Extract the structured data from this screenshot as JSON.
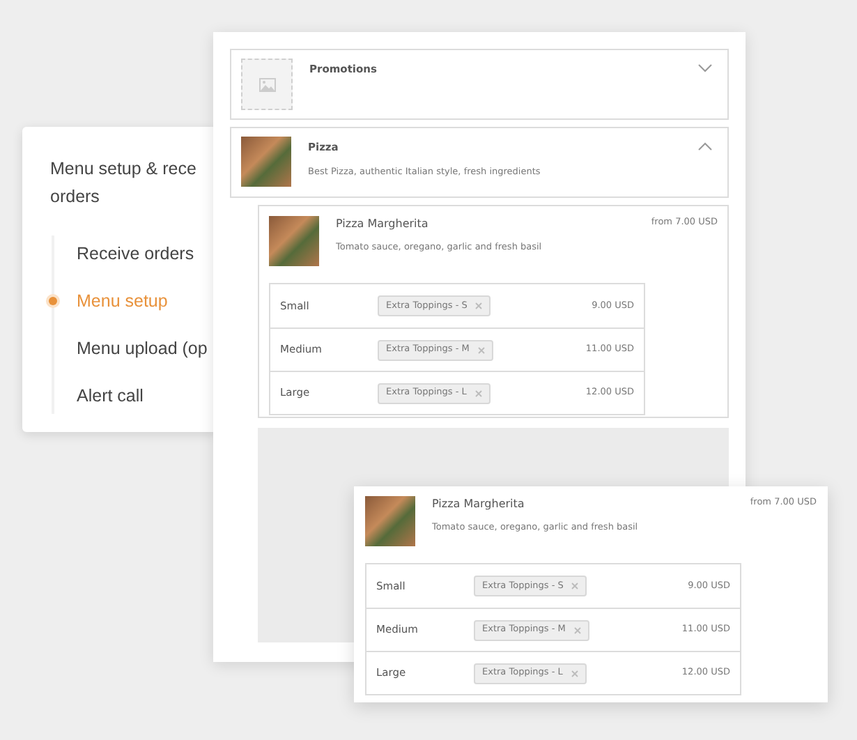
{
  "steps_card": {
    "title_lines": [
      "Menu setup & rece",
      "orders"
    ],
    "steps": [
      {
        "label": "Receive orders",
        "selected": false
      },
      {
        "label": "Menu setup",
        "selected": true
      },
      {
        "label": "Menu upload (op",
        "selected": false
      },
      {
        "label": "Alert call",
        "selected": false
      }
    ]
  },
  "categories": [
    {
      "name": "Promotions",
      "expanded": false,
      "has_photo": false
    },
    {
      "name": "Pizza",
      "description": "Best Pizza, authentic Italian style, fresh ingredients",
      "expanded": true,
      "has_photo": true
    }
  ],
  "menu_item": {
    "name": "Pizza Margherita",
    "description": "Tomato sauce, oregano, garlic and fresh basil",
    "price": "from 7.00 USD",
    "variants": [
      {
        "size": "Small",
        "tag": "Extra Toppings - S",
        "price": "9.00 USD"
      },
      {
        "size": "Medium",
        "tag": "Extra Toppings - M",
        "price": "11.00 USD"
      },
      {
        "size": "Large",
        "tag": "Extra Toppings - L",
        "price": "12.00 USD"
      }
    ]
  },
  "dragged_item": {
    "name": "Pizza Margherita",
    "description": "Tomato sauce, oregano, garlic and fresh basil",
    "price": "from 7.00 USD",
    "variants": [
      {
        "size": "Small",
        "tag": "Extra Toppings - S",
        "price": "9.00 USD"
      },
      {
        "size": "Medium",
        "tag": "Extra Toppings - M",
        "price": "11.00 USD"
      },
      {
        "size": "Large",
        "tag": "Extra Toppings - L",
        "price": "12.00 USD"
      }
    ]
  }
}
